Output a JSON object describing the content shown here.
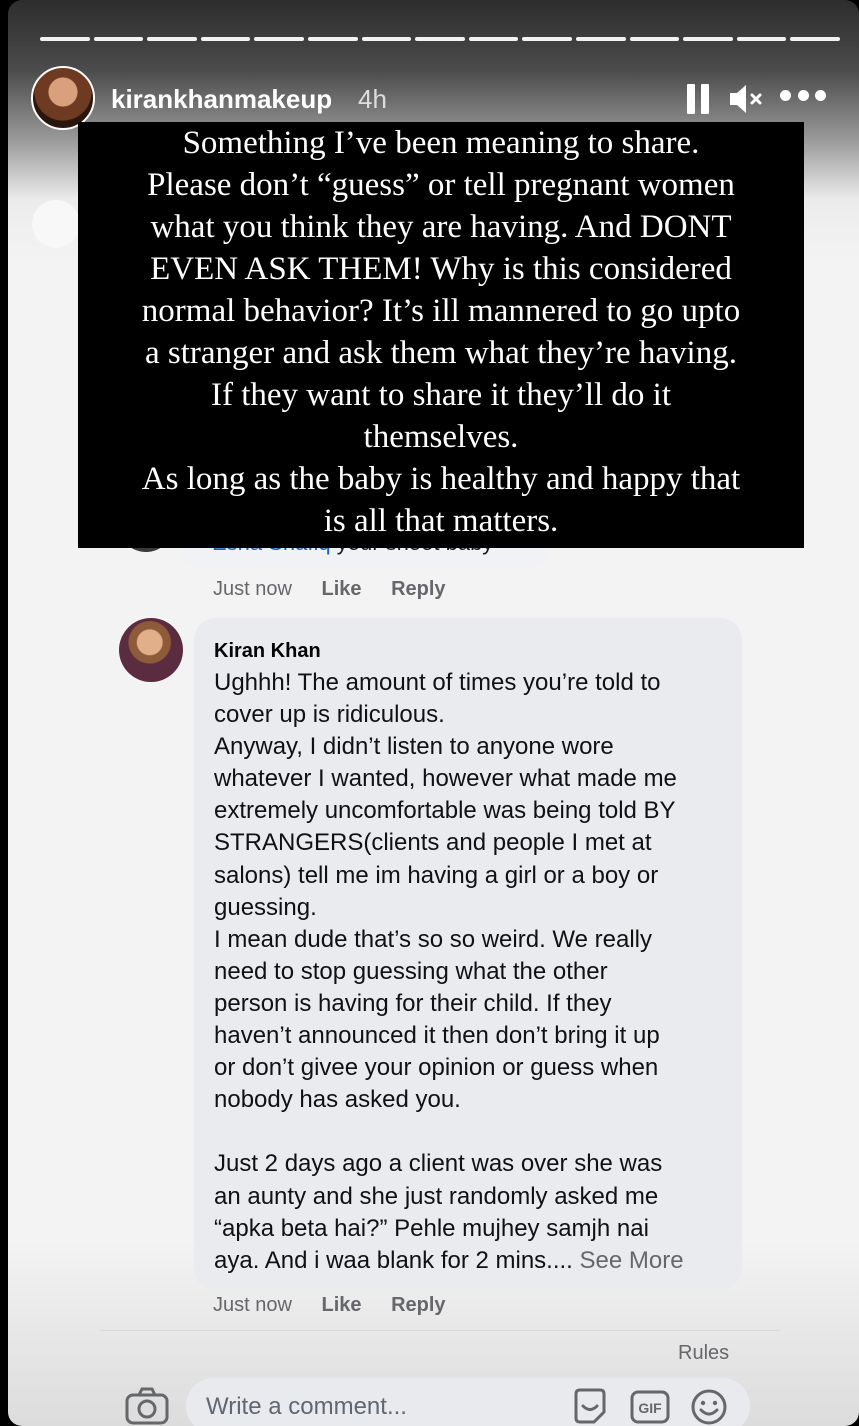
{
  "header": {
    "username": "kirankhanmakeup",
    "time": "4h",
    "progress_segments": 15
  },
  "overlay_text": {
    "lines": [
      "Something I’ve been meaning to share.",
      "Please don’t “guess” or tell pregnant women",
      "what you think they are having. And DONT",
      "EVEN ASK THEM! Why is this considered",
      "normal behavior? It’s ill mannered to go upto",
      "a stranger and ask them what they’re having.",
      "If they want to share it they’ll do it",
      "themselves.",
      "As long as the baby is healthy and happy that",
      "is all that matters."
    ]
  },
  "previous_comment": {
    "mention": "Esha Shafiq",
    "text": " your shoot baby",
    "time": "Just now",
    "like": "Like",
    "reply": "Reply"
  },
  "comment": {
    "author": "Kiran Khan",
    "text": "Ughhh! The amount of times you’re told to\ncover up is ridiculous.\nAnyway, I didn’t listen to anyone wore\nwhatever I wanted, however what made me\nextremely uncomfortable was being told BY\nSTRANGERS(clients and people I met at\nsalons) tell me im having a girl or a boy or\nguessing.\nI mean dude that’s so so weird. We really\nneed to stop guessing what the other\nperson is having for their child. If they\nhaven’t announced it then don’t bring it up\nor don’t givee your opinion or guess when\nnobody has asked you.\n\nJust 2 days ago a client was over she was\nan aunty and she just randomly asked me\n“apka beta hai?” Pehle mujhey samjh nai\naya. And i waa blank for 2 mins.... ",
    "see_more": "See More",
    "time": "Just now",
    "like": "Like",
    "reply": "Reply"
  },
  "footer": {
    "rules": "Rules",
    "input_placeholder": "Write a comment...",
    "gif_label": "GIF"
  },
  "icons": [
    "pause-icon",
    "mute-icon",
    "more-icon",
    "camera-icon",
    "sticker-icon",
    "gif-icon",
    "emoji-icon"
  ]
}
